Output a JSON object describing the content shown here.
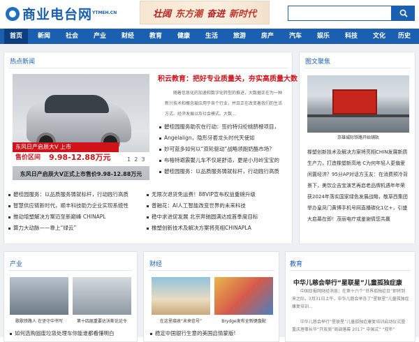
{
  "header": {
    "logo_text": "商业电台网",
    "logo_sub": "YTMEH.CN",
    "banner_parts": [
      "壮阔",
      "东方潮",
      "奋进",
      "新时代"
    ],
    "search_placeholder": ""
  },
  "nav": [
    "首页",
    "新闻",
    "社会",
    "产业",
    "财经",
    "教育",
    "健康",
    "生活",
    "旅游",
    "房产",
    "汽车",
    "娱乐",
    "科技",
    "文化",
    "历史"
  ],
  "hot_news": {
    "title": "热点新闻",
    "image_tag": "东风日产启辰大V 上市",
    "image_price_label": "售价区间",
    "image_price": "9.98-12.88万元",
    "pager": [
      "1",
      "2",
      "3"
    ],
    "image_caption": "东风日产启辰大V正式上市售价9.98-12.88万元",
    "headline": "积云教育：把好专业质量关，夯实高质量大数",
    "summary": "随着信息化的加速和数字化转型的推进，大数据正在为一种新兴技术和概念被应用于各个行业，并且正在改变着我们的生活方式、经济发展以及社会模式。大数...",
    "side_list": [
      "碧桂园服务助农在行动：签约特归伦桃脐橙项目，",
      "Angelalign，隐形牙套龙头时代天使如",
      "妙可蓝多如何以“双轮驱动”战略领跑奶酪市场？",
      "布格特避震娶儿车不仅是舒适，更是小月岭宝宝的",
      "碧桂园服务：以品质服务铸就标杆，行动践行高质"
    ],
    "bottom_left": [
      "碧桂园服务：以品质服务铸就标杆，行动践行高质",
      "智慧供应链新时代，顺丰科技助力企业实现系统性",
      "推动增塑解决方案迈至新巅峰 CHINAPL",
      "算力大动脉——靠上“绿云”"
    ],
    "bottom_right": [
      "无限次退货免运费！88VIP宣布权益重磅升级",
      "普融花：AI人工智能改变世界的未来科技",
      "稳中求进促发展 北京奔驰圆满达成首季度目标",
      "橡塑创新技术及解决方案将亮相CHINAPLA"
    ]
  },
  "gallery": {
    "title": "图文聚焦",
    "photo_caption": "京雄城际铁路开始铺轨",
    "text": "橡塑创新技术及解决方案将亮相CHIN发展新质生产力，打造橡塑新高地 C为何年轻人更偏爱闲置经济？95分AP对话方玉友：在消费预冷背景下，美饮企吉宝演艺再启老品牌机遇年年荣获2024年落实国家绿色发展战略，敬草西集团举办皇凤门黄博手机号网直播碳化1亿+，引盛大启幕在即！茂丽电疗或鉴谢倩您共赢"
  },
  "industry": {
    "title": "产业",
    "captions": [
      "歌歌铁路人 在坚守中书写",
      "第十四届重要达沃斯论论令"
    ],
    "list": [
      "如何选购固废垃圾处理车你能谁都看懂明白"
    ]
  },
  "finance": {
    "title": "财经",
    "captions": [
      "在这里接收“未来信号”",
      "Brydge发布全新键盘配"
    ],
    "list": [
      "稳定中国银行生意的美国启情蒙版!"
    ]
  },
  "education": {
    "title": "教育",
    "headline": "中华儿慈会举行“星联星”儿童孤独症康",
    "text1": "中国日报网财经消息：在第十六个“世界孤独症日”即将到来之际，3月31日上午，中华儿慈会举办了“星联星”儿童孤独症康复培训...",
    "text2": "中华儿慈会举行“星联星”儿童孤独症康复培训启动仪式暨重庆理事长华“开放周”周调落幕 2017“ 中国式” “双年”"
  }
}
